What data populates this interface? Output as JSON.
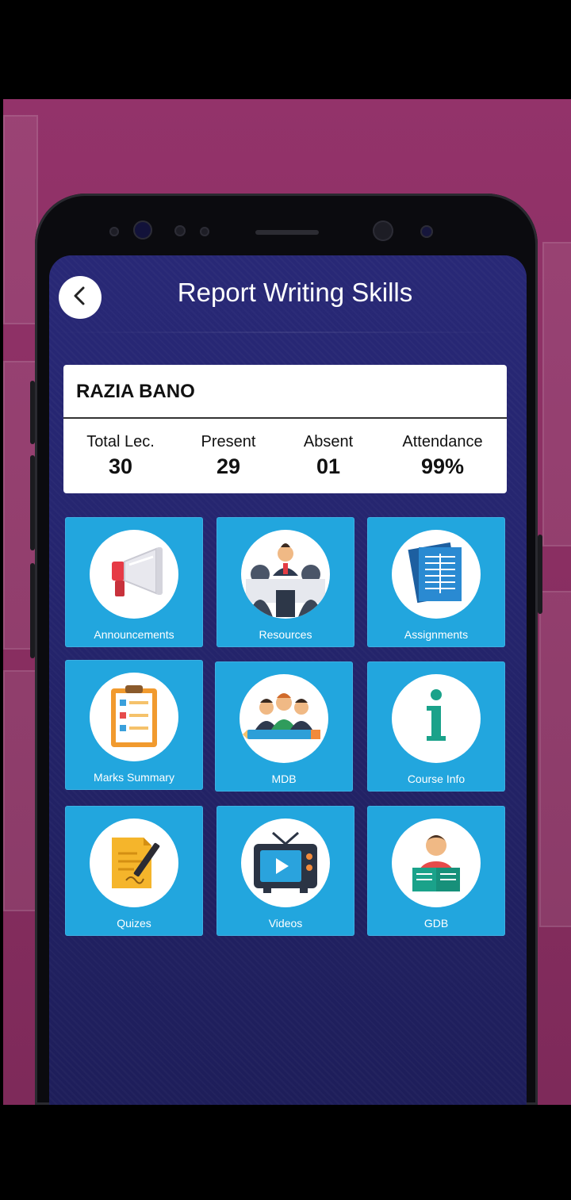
{
  "header": {
    "title": "Report Writing Skills",
    "back_icon": "chevron-left-icon"
  },
  "student": {
    "name": "RAZIA BANO"
  },
  "stats": [
    {
      "label": "Total Lec.",
      "value": "30"
    },
    {
      "label": "Present",
      "value": "29"
    },
    {
      "label": "Absent",
      "value": "01"
    },
    {
      "label": "Attendance",
      "value": "99%"
    }
  ],
  "tiles": [
    {
      "label": "Announcements",
      "icon": "megaphone-icon"
    },
    {
      "label": "Resources",
      "icon": "meeting-icon"
    },
    {
      "label": "Assignments",
      "icon": "documents-icon"
    },
    {
      "label": "Marks Summary",
      "icon": "clipboard-icon"
    },
    {
      "label": "MDB",
      "icon": "discussion-group-icon"
    },
    {
      "label": "Course Info",
      "icon": "info-icon"
    },
    {
      "label": "Quizes",
      "icon": "paper-pen-icon"
    },
    {
      "label": "Videos",
      "icon": "tv-play-icon"
    },
    {
      "label": "GDB",
      "icon": "reader-icon"
    }
  ],
  "colors": {
    "screen_bg": "#25256f",
    "tile_bg": "#22a6de",
    "promo_bg": "#8a2f62"
  }
}
